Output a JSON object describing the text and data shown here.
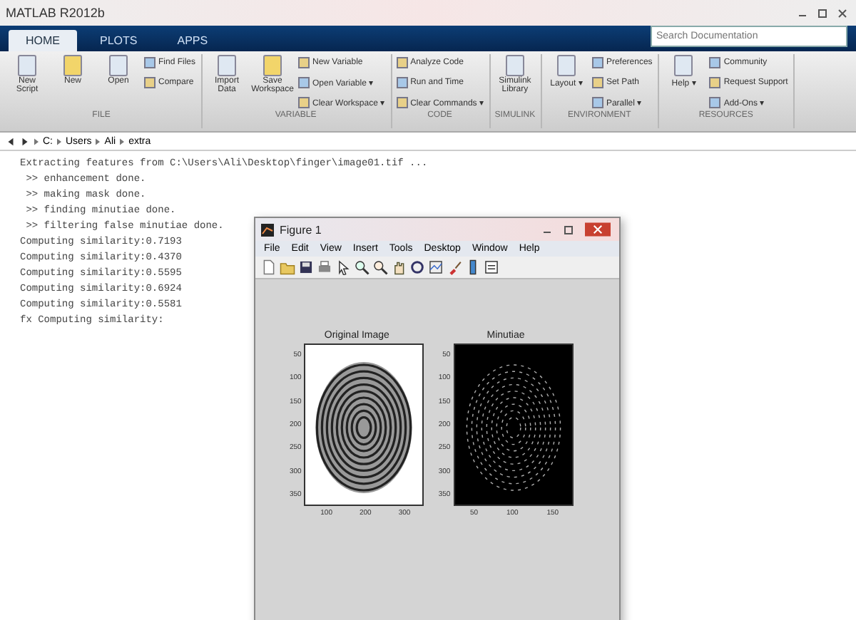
{
  "window": {
    "title": "MATLAB R2012b"
  },
  "tabs": [
    {
      "label": "HOME",
      "selected": true
    },
    {
      "label": "PLOTS",
      "selected": false
    },
    {
      "label": "APPS",
      "selected": false
    }
  ],
  "search": {
    "placeholder": "Search Documentation"
  },
  "ribbon": [
    {
      "group": "FILE",
      "items": [
        {
          "label": "New Script",
          "kind": "large"
        },
        {
          "label": "New",
          "kind": "large"
        },
        {
          "label": "Open",
          "kind": "large"
        },
        {
          "label": "Find Files",
          "kind": "small"
        },
        {
          "label": "Compare",
          "kind": "small"
        }
      ]
    },
    {
      "group": "VARIABLE",
      "items": [
        {
          "label": "Import Data",
          "kind": "large"
        },
        {
          "label": "Save Workspace",
          "kind": "large"
        },
        {
          "label": "New Variable",
          "kind": "small"
        },
        {
          "label": "Open Variable ▾",
          "kind": "small"
        },
        {
          "label": "Clear Workspace ▾",
          "kind": "small"
        }
      ]
    },
    {
      "group": "CODE",
      "items": [
        {
          "label": "Analyze Code",
          "kind": "small"
        },
        {
          "label": "Run and Time",
          "kind": "small"
        },
        {
          "label": "Clear Commands ▾",
          "kind": "small"
        }
      ]
    },
    {
      "group": "SIMULINK",
      "items": [
        {
          "label": "Simulink Library",
          "kind": "large"
        }
      ]
    },
    {
      "group": "ENVIRONMENT",
      "items": [
        {
          "label": "Layout ▾",
          "kind": "large"
        },
        {
          "label": "Preferences",
          "kind": "small"
        },
        {
          "label": "Set Path",
          "kind": "small"
        },
        {
          "label": "Parallel ▾",
          "kind": "small"
        }
      ]
    },
    {
      "group": "RESOURCES",
      "items": [
        {
          "label": "Help ▾",
          "kind": "large"
        },
        {
          "label": "Community",
          "kind": "small"
        },
        {
          "label": "Request Support",
          "kind": "small"
        },
        {
          "label": "Add-Ons ▾",
          "kind": "small"
        }
      ]
    }
  ],
  "path": [
    "C:",
    "Users",
    "Ali",
    "extra"
  ],
  "console": [
    "Extracting features from C:\\Users\\Ali\\Desktop\\finger\\image01.tif ...",
    " >> enhancement done.",
    " >> making mask done.",
    " >> finding minutiae done.",
    " >> filtering false minutiae done.",
    "Computing similarity:0.7193",
    "Computing similarity:0.4370",
    "Computing similarity:0.5595",
    "Computing similarity:0.6924",
    "Computing similarity:0.5581",
    "fx Computing similarity:"
  ],
  "figure": {
    "title": "Figure 1",
    "menu": [
      "File",
      "Edit",
      "View",
      "Insert",
      "Tools",
      "Desktop",
      "Window",
      "Help"
    ],
    "axes": [
      {
        "title": "Original Image",
        "kind": "light",
        "yticks": [
          "50",
          "100",
          "150",
          "200",
          "250",
          "300",
          "350"
        ],
        "xticks": [
          "100",
          "200",
          "300"
        ]
      },
      {
        "title": "Minutiae",
        "kind": "dark",
        "yticks": [
          "50",
          "100",
          "150",
          "200",
          "250",
          "300",
          "350"
        ],
        "xticks": [
          "50",
          "100",
          "150"
        ]
      }
    ]
  }
}
